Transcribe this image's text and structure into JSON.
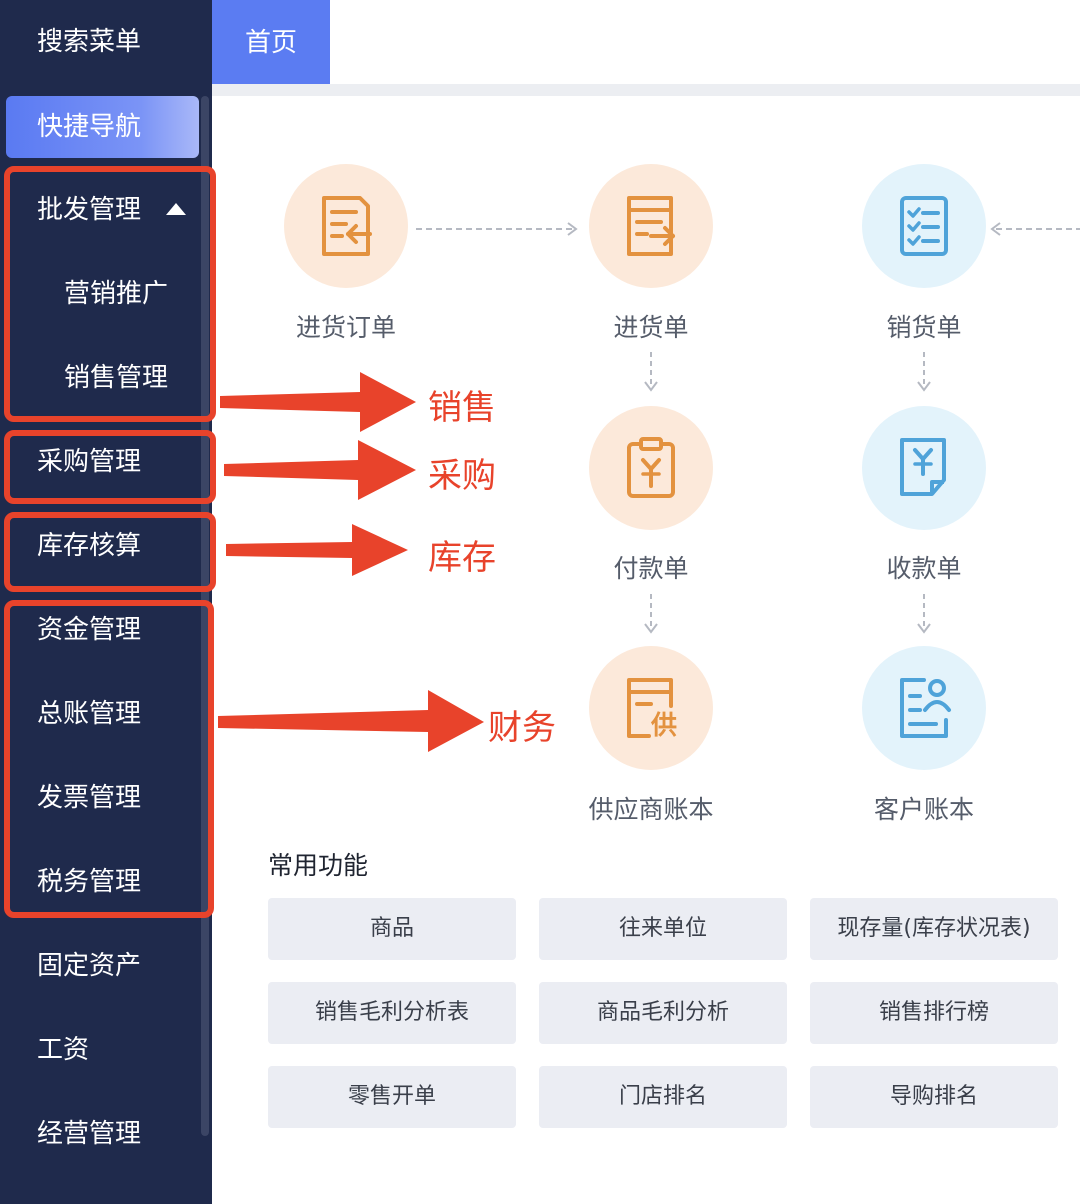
{
  "sidebar": {
    "search_label": "搜索菜单",
    "quick_nav_label": "快捷导航",
    "items": [
      {
        "label": "批发管理"
      },
      {
        "label": "营销推广"
      },
      {
        "label": "销售管理"
      },
      {
        "label": "采购管理"
      },
      {
        "label": "库存核算"
      },
      {
        "label": "资金管理"
      },
      {
        "label": "总账管理"
      },
      {
        "label": "发票管理"
      },
      {
        "label": "税务管理"
      },
      {
        "label": "固定资产"
      },
      {
        "label": "工资"
      },
      {
        "label": "经营管理"
      }
    ]
  },
  "tabs": {
    "home": "首页"
  },
  "annotations": {
    "sales": "销售",
    "purchase": "采购",
    "inventory": "库存",
    "finance": "财务"
  },
  "flow": {
    "purchase_order": "进货订单",
    "purchase_receipt": "进货单",
    "sales_order": "销货单",
    "payment": "付款单",
    "receipt": "收款单",
    "supplier_ledger": "供应商账本",
    "customer_ledger": "客户账本"
  },
  "common": {
    "title": "常用功能",
    "buttons": [
      "商品",
      "往来单位",
      "现存量(库存状况表)",
      "销售毛利分析表",
      "商品毛利分析",
      "销售排行榜",
      "零售开单",
      "门店排名",
      "导购排名"
    ]
  },
  "colors": {
    "sidebar_bg": "#1f2a4c",
    "accent": "#5b7cf2",
    "highlight": "#e8432b",
    "orange_icon": "#e3923f",
    "blue_icon": "#4fa3d9"
  }
}
